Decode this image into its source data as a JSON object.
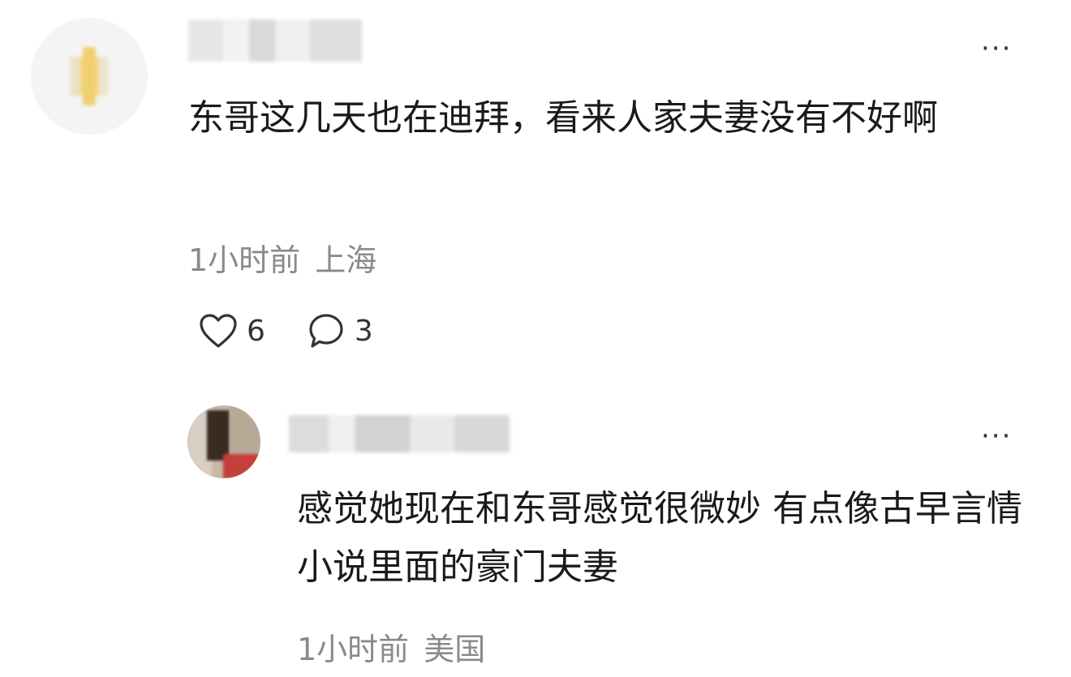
{
  "comments": [
    {
      "text": "东哥这几天也在迪拜，看来人家夫妻没有不好啊",
      "time": "1小时前",
      "location": "上海",
      "likes": "6",
      "replies": "3",
      "more_label": "···"
    }
  ],
  "reply": {
    "text": "感觉她现在和东哥感觉很微妙 有点像古早言情小说里面的豪门夫妻",
    "time": "1小时前",
    "location": "美国",
    "more_label": "···"
  },
  "icons": {
    "like": "heart-icon",
    "reply": "comment-bubble-icon",
    "more": "more-options-icon"
  },
  "colors": {
    "text": "#1a1a1a",
    "meta": "#8a8a8a",
    "background": "#ffffff"
  }
}
